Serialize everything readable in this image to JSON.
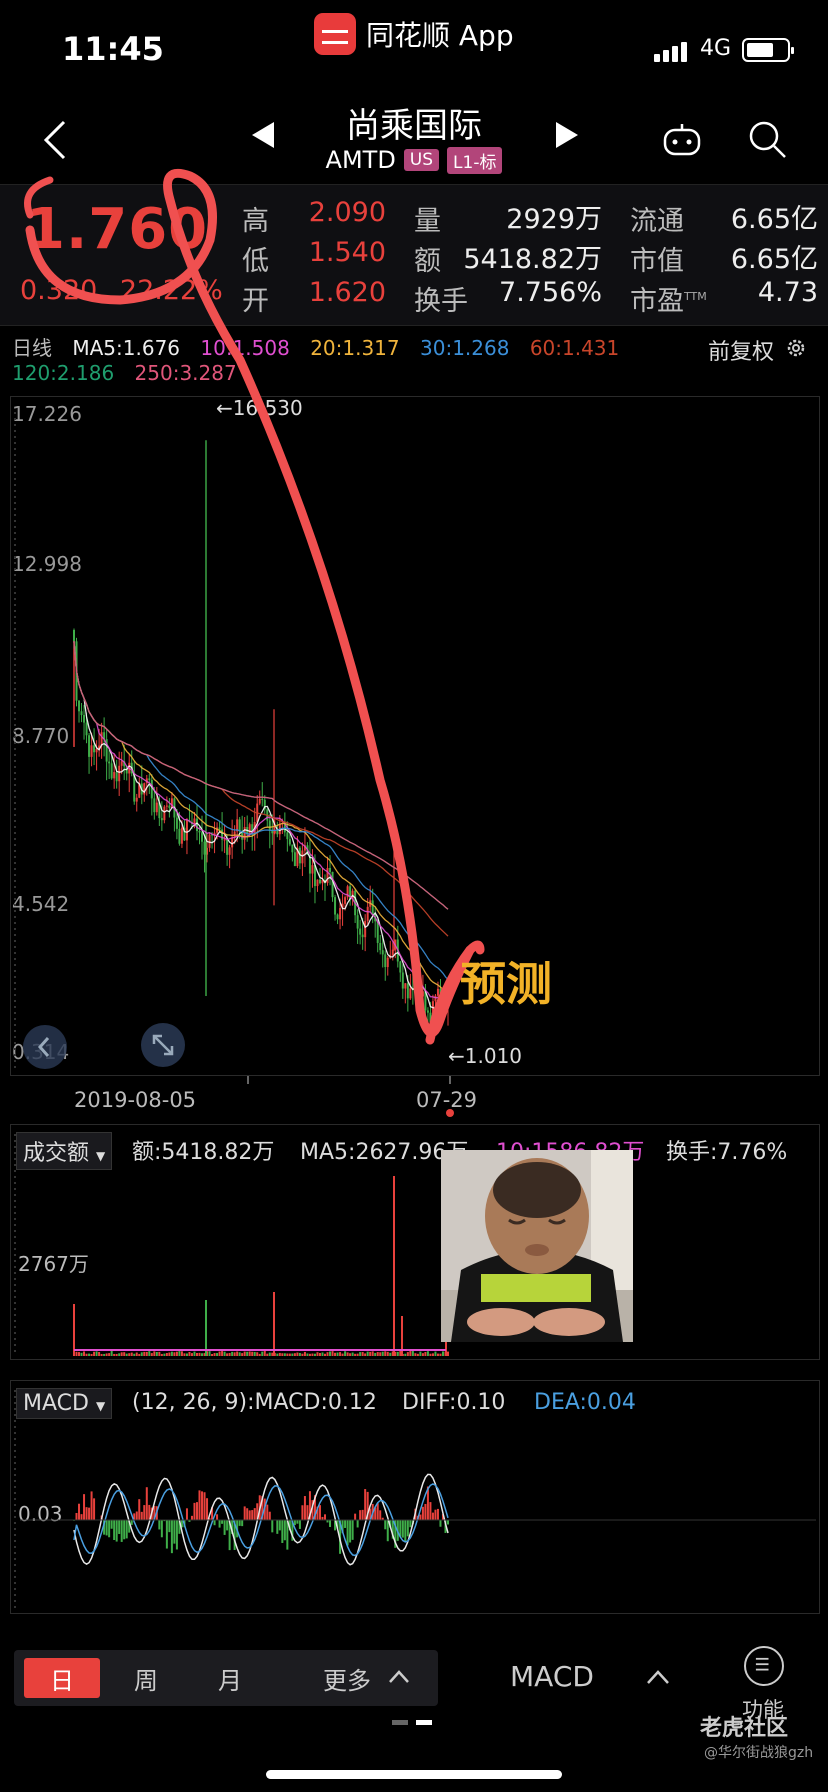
{
  "status": {
    "time": "11:45",
    "app_name": "同花顺 App",
    "network": "4G"
  },
  "nav": {
    "title": "尚乘国际",
    "code": "AMTD",
    "badge_market": "US",
    "badge_level": "L1-标"
  },
  "quote": {
    "price": "1.760",
    "change": "0.320",
    "change_pct": "22.22%",
    "high_label": "高",
    "high": "2.090",
    "low_label": "低",
    "low": "1.540",
    "open_label": "开",
    "open": "1.620",
    "vol_label": "量",
    "vol": "2929万",
    "amount_label": "额",
    "amount": "5418.82万",
    "turnover_label": "换手",
    "turnover": "7.756%",
    "float_label": "流通",
    "float": "6.65亿",
    "mcap_label": "市值",
    "mcap": "6.65亿",
    "pe_label": "市盈",
    "pe_sup": "TTM",
    "pe": "4.73"
  },
  "ma_legend": {
    "period": "日线",
    "ma5": "MA5:1.676",
    "ma10": "10:1.508",
    "ma20": "20:1.317",
    "ma30": "30:1.268",
    "ma60": "60:1.431",
    "ma120": "120:2.186",
    "ma250": "250:3.287",
    "adjust": "前复权"
  },
  "colors": {
    "up": "#e8413c",
    "down": "#3fae49",
    "ma5": "#ffffff",
    "ma10": "#e04fd0",
    "ma20": "#f0b43c",
    "ma30": "#3b8fd8",
    "ma60": "#c8452a",
    "ma120": "#1f9e6e",
    "ma250": "#e0567a"
  },
  "kline": {
    "y_labels": [
      "17.226",
      "12.998",
      "8.770",
      "4.542",
      "0.314"
    ],
    "max_marker": "←16.530",
    "min_marker": "←1.010",
    "date_start": "2019-08-05",
    "date_end": "07-29"
  },
  "volume": {
    "selector": "成交额",
    "amount": "额:5418.82万",
    "ma5": "MA5:2627.96万",
    "ma10": "10:1586.82万",
    "turnover": "换手:7.76%",
    "y_label": "2767万"
  },
  "macd": {
    "selector": "MACD",
    "params": "(12, 26, 9):MACD:0.12",
    "diff": "DIFF:0.10",
    "dea": "DEA:0.04",
    "y_label": "0.03"
  },
  "annotation": {
    "predict": "预测"
  },
  "bottom": {
    "tabs": [
      "日",
      "周",
      "月",
      "更多"
    ],
    "indicator": "MACD",
    "func": "功能",
    "watermark": "老虎社区",
    "watermark_sub": "@华尔街战狼gzh"
  }
}
